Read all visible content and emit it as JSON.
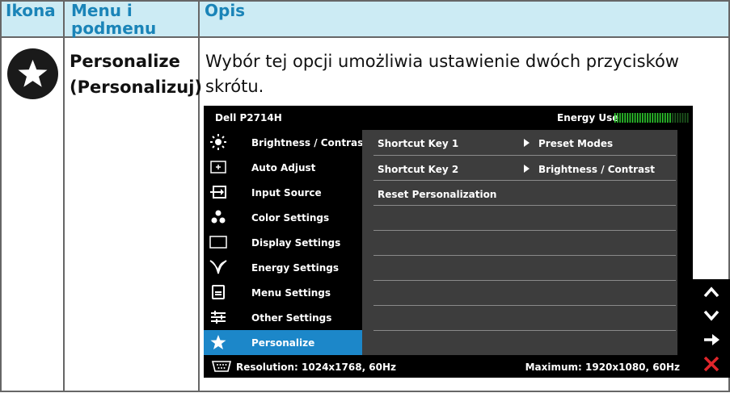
{
  "table": {
    "headers": [
      "Ikona",
      "Menu i podmenu",
      "Opis"
    ],
    "headers_lines": {
      "menu_line1": "Menu i",
      "menu_line2": "podmenu"
    },
    "row": {
      "icon": "star-icon",
      "menu_line1": "Personalize",
      "menu_line2": "(Personalizuj)",
      "desc_line1": "Wybór tej opcji umożliwia ustawienie dwóch przycisków",
      "desc_line2": "skrótu."
    }
  },
  "osd": {
    "title": "Dell P2714H",
    "energy_label": "Energy Use",
    "energy_level": 0.78,
    "menu": [
      {
        "label": "Brightness / Contrast",
        "icon": "brightness-icon",
        "active": false
      },
      {
        "label": "Auto Adjust",
        "icon": "auto-adjust-icon",
        "active": false
      },
      {
        "label": "Input Source",
        "icon": "input-source-icon",
        "active": false
      },
      {
        "label": "Color Settings",
        "icon": "color-settings-icon",
        "active": false
      },
      {
        "label": "Display Settings",
        "icon": "display-settings-icon",
        "active": false
      },
      {
        "label": "Energy Settings",
        "icon": "energy-settings-icon",
        "active": false
      },
      {
        "label": "Menu Settings",
        "icon": "menu-settings-icon",
        "active": false
      },
      {
        "label": "Other Settings",
        "icon": "other-settings-icon",
        "active": false
      },
      {
        "label": "Personalize",
        "icon": "star-icon",
        "active": true
      }
    ],
    "submenu": [
      {
        "label": "Shortcut Key 1",
        "value": "Preset Modes"
      },
      {
        "label": "Shortcut Key 2",
        "value": "Brightness / Contrast"
      },
      {
        "label": "Reset Personalization",
        "value": ""
      }
    ],
    "status_left": "Resolution: 1024x1768, 60Hz",
    "status_right": "Maximum: 1920x1080, 60Hz",
    "nav_buttons": [
      "up-arrow-icon",
      "down-arrow-icon",
      "right-arrow-icon",
      "close-icon"
    ]
  },
  "colors": {
    "header_bg": "#ccebf4",
    "header_text": "#1a84b8",
    "active_menu": "#1c87c9",
    "energy_bar": "#2fd02f",
    "close_red": "#e0262b"
  }
}
